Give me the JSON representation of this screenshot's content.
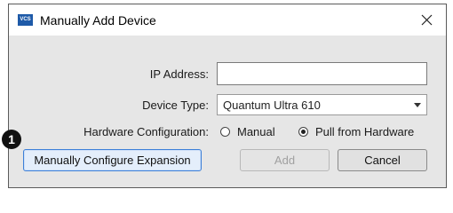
{
  "window": {
    "app_icon_text": "VCS",
    "title": "Manually Add Device"
  },
  "form": {
    "ip_label": "IP Address:",
    "ip_value": "",
    "device_type_label": "Device Type:",
    "device_type_selected": "Quantum Ultra 610",
    "hw_config_label": "Hardware Configuration:",
    "hw_options": [
      {
        "label": "Manual",
        "selected": false
      },
      {
        "label": "Pull from Hardware",
        "selected": true
      }
    ]
  },
  "buttons": {
    "configure_expansion": "Manually Configure Expansion",
    "add": "Add",
    "cancel": "Cancel"
  },
  "callout_number": "1"
}
